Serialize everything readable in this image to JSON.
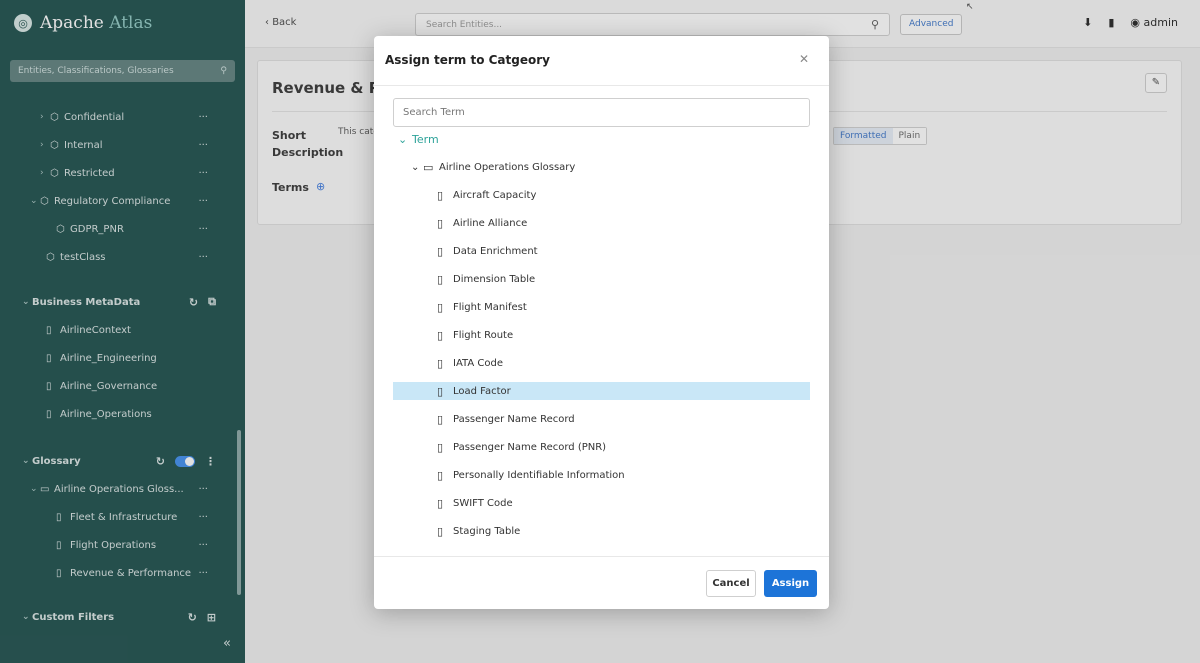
{
  "sidebar": {
    "brand_apache": "Apache",
    "brand_atlas": "Atlas",
    "search_placeholder": "Entities, Classifications, Glossaries",
    "classifications": [
      {
        "label": "Confidential"
      },
      {
        "label": "Internal"
      },
      {
        "label": "Restricted"
      },
      {
        "label": "Regulatory Compliance"
      },
      {
        "label": "GDPR_PNR"
      },
      {
        "label": "testClass"
      }
    ],
    "business_metadata": {
      "title": "Business MetaData",
      "items": [
        "AirlineContext",
        "Airline_Engineering",
        "Airline_Governance",
        "Airline_Operations"
      ]
    },
    "glossary": {
      "title": "Glossary",
      "root": "Airline Operations Gloss...",
      "items": [
        "Fleet & Infrastructure",
        "Flight Operations",
        "Revenue & Performance"
      ]
    },
    "custom_filters": "Custom Filters",
    "more_glyph": "···"
  },
  "topbar": {
    "back_label": "Back",
    "search_placeholder": "Search Entities...",
    "advanced_label": "Advanced",
    "user_label": "admin"
  },
  "page": {
    "title": "Revenue & Pe",
    "short_description_label": "Short Description",
    "short_description_value": "This cate",
    "terms_label": "Terms",
    "format_on": "Formatted",
    "format_off": "Plain"
  },
  "modal": {
    "title": "Assign term to Catgeory",
    "search_placeholder": "Search Term",
    "root_label": "Term",
    "glossary_label": "Airline Operations Glossary",
    "terms": [
      "Aircraft Capacity",
      "Airline Alliance",
      "Data Enrichment",
      "Dimension Table",
      "Flight Manifest",
      "Flight Route",
      "IATA Code",
      "Load Factor",
      "Passenger Name Record",
      "Passenger Name Record (PNR)",
      "Personally Identifiable Information",
      "SWIFT Code",
      "Staging Table"
    ],
    "selected_term": "Load Factor",
    "cancel_label": "Cancel",
    "assign_label": "Assign"
  },
  "colors": {
    "sidebar_bg": "#1a4d4a",
    "accent_blue": "#1d74d8",
    "selection": "#c9e7f7",
    "tree_root": "#2ea39a"
  }
}
